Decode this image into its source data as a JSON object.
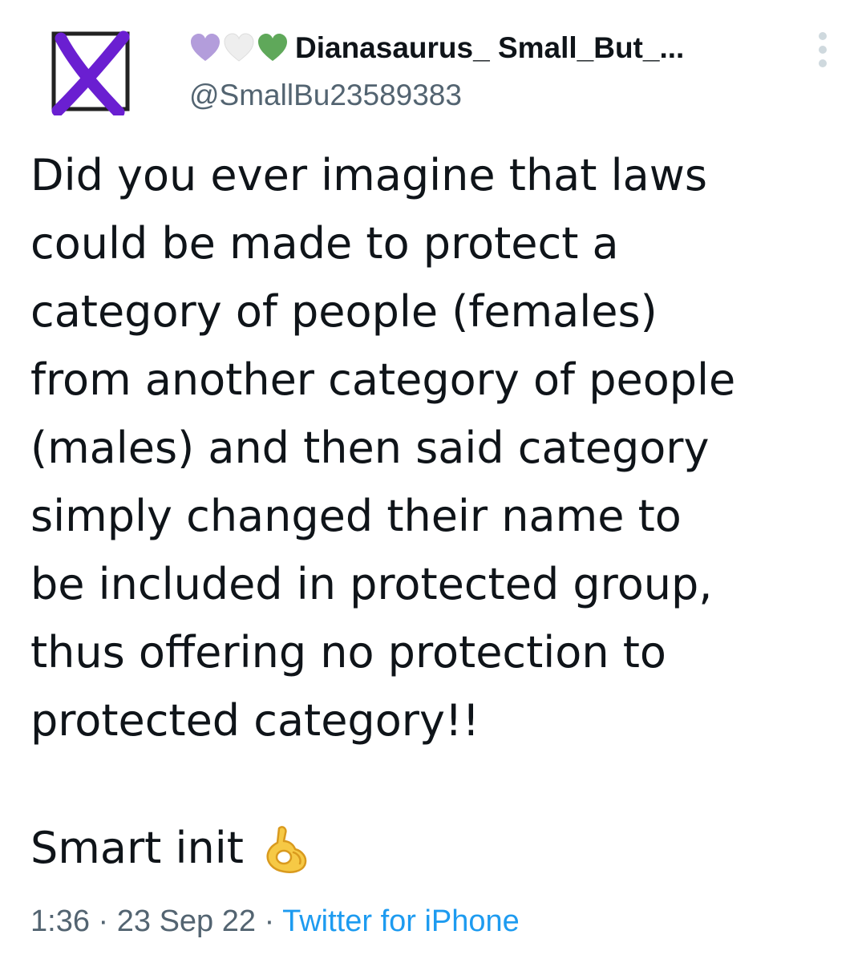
{
  "tweet": {
    "author": {
      "display_name": "Dianasaurus_ Small_But_...",
      "handle": "@SmallBu23589383",
      "name_emojis": [
        {
          "icon": "purple-heart",
          "color": "#b39ddb"
        },
        {
          "icon": "white-heart",
          "color": "#eeeeee"
        },
        {
          "icon": "green-heart",
          "color": "#5fa85a"
        }
      ],
      "avatar_colors": {
        "box": "#222222",
        "cross": "#6a1fd1"
      }
    },
    "text_lines": [
      "Did you ever imagine that laws",
      "could be made to protect a",
      "category of people (females)",
      "from another category of people",
      "(males) and then said category",
      "simply changed their name to",
      "be included in protected group,",
      "thus offering no protection to",
      "protected category!!"
    ],
    "closing_text": "Smart init",
    "closing_emoji": "ok-hand",
    "time": "1:36",
    "date": "23 Sep 22",
    "separator": "·",
    "source": "Twitter for iPhone",
    "colors": {
      "text": "#0f1419",
      "secondary": "#536471",
      "link": "#1d9bf0"
    }
  }
}
